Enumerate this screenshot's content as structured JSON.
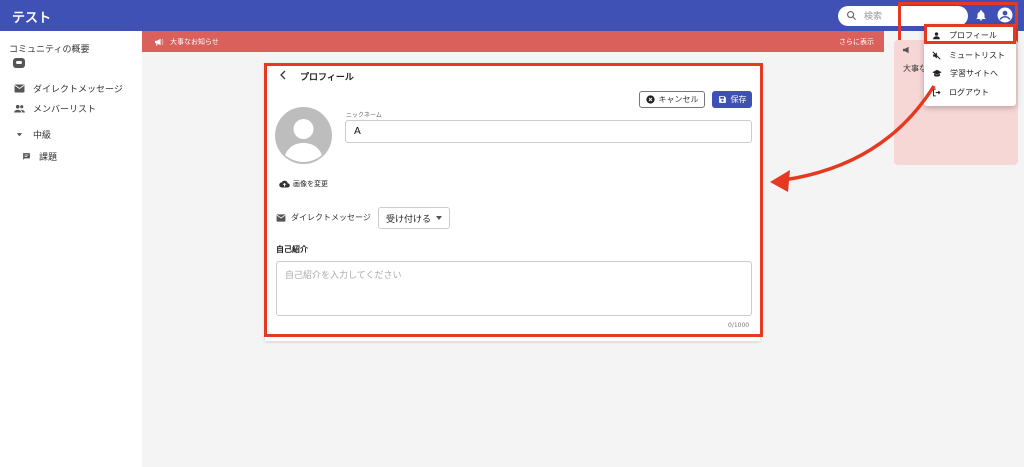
{
  "app": {
    "title": "テスト"
  },
  "header": {
    "search_placeholder": "検索"
  },
  "sidebar": {
    "community_overview": "コミュニティの概要",
    "items": [
      {
        "label": "ダイレクトメッセージ",
        "icon": "mail-icon"
      },
      {
        "label": "メンバーリスト",
        "icon": "people-icon"
      },
      {
        "label": "中級",
        "icon": "caret-down-icon"
      },
      {
        "label": "課題",
        "icon": "chat-icon"
      }
    ]
  },
  "banner": {
    "label": "大事なお知らせ",
    "more": "さらに表示"
  },
  "right_panel": {
    "snippet": "大事な"
  },
  "profile": {
    "title": "プロフィール",
    "cancel_label": "キャンセル",
    "save_label": "保存",
    "change_photo_label": "画像を変更",
    "nickname_label": "ニックネーム",
    "nickname_value": "A",
    "dm_label": "ダイレクトメッセージ",
    "dm_setting": "受け付ける",
    "bio_label": "自己紹介",
    "bio_placeholder": "自己紹介を入力してください",
    "bio_counter": "0/1000"
  },
  "account_menu": {
    "items": [
      {
        "label": "プロフィール",
        "icon": "person-icon"
      },
      {
        "label": "ミュートリスト",
        "icon": "mute-icon"
      },
      {
        "label": "学習サイトへ",
        "icon": "school-icon"
      },
      {
        "label": "ログアウト",
        "icon": "logout-icon"
      }
    ]
  },
  "colors": {
    "primary": "#3f51b5",
    "banner": "#d9605b",
    "highlight": "#e53922",
    "right_panel": "#f7d7d6"
  }
}
